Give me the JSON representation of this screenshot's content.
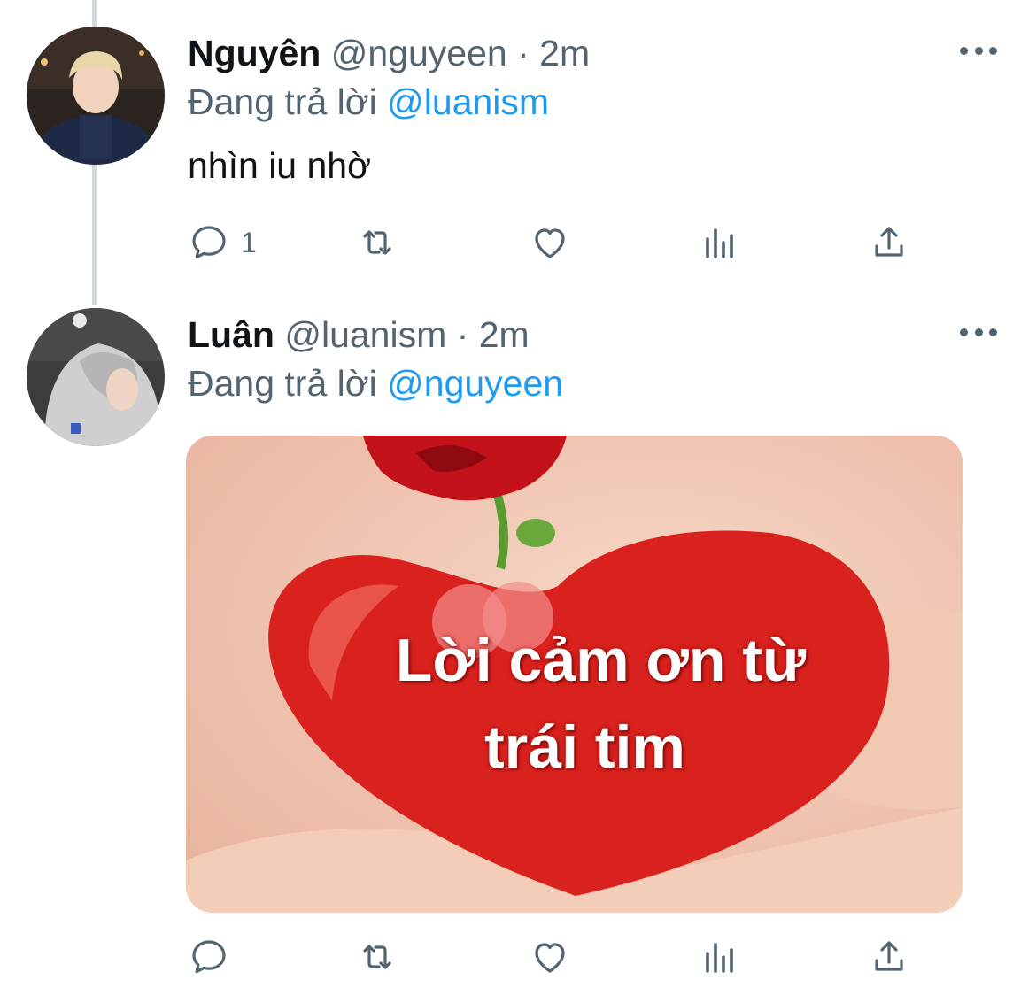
{
  "colors": {
    "text": "#0f1419",
    "secondary": "#536471",
    "accent": "#1d9bf0",
    "thread_line": "#cfd9de"
  },
  "tweets": [
    {
      "display_name": "Nguyên",
      "handle": "@nguyeen",
      "separator": "·",
      "time": "2m",
      "reply_prefix": "Đang trả lời",
      "reply_to": "@luanism",
      "text": "nhìn iu nhờ",
      "reply_count": "1",
      "retweet_count": "",
      "like_count": "",
      "icons": [
        "reply-icon",
        "retweet-icon",
        "like-icon",
        "views-icon",
        "share-icon"
      ]
    },
    {
      "display_name": "Luân",
      "handle": "@luanism",
      "separator": "·",
      "time": "2m",
      "reply_prefix": "Đang trả lời",
      "reply_to": "@nguyeen",
      "media_caption_line1": "Lời cảm ơn từ",
      "media_caption_line2": "trái tim",
      "reply_count": "",
      "retweet_count": "",
      "like_count": "",
      "icons": [
        "reply-icon",
        "retweet-icon",
        "like-icon",
        "views-icon",
        "share-icon"
      ]
    }
  ]
}
